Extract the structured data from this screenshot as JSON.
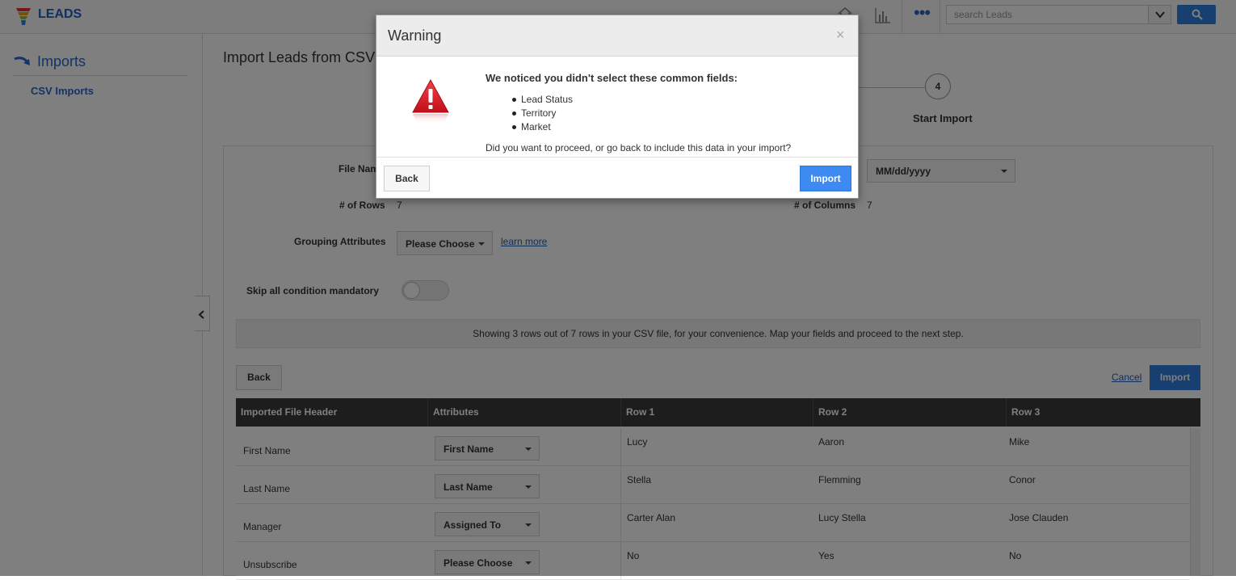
{
  "app": {
    "title": "LEADS"
  },
  "search": {
    "placeholder": "search Leads"
  },
  "sidebar": {
    "title": "Imports",
    "items": [
      {
        "label": "CSV Imports"
      }
    ]
  },
  "page": {
    "title": "Import Leads from CSV",
    "step": {
      "number": "4",
      "label": "Start Import"
    }
  },
  "form": {
    "file_name_label": "File Name",
    "rows_label": "# of Rows",
    "rows_value": "7",
    "columns_label": "# of Columns",
    "columns_value": "7",
    "date_format": "MM/dd/yyyy",
    "grouping_label": "Grouping Attributes",
    "grouping_value": "Please Choose",
    "learn_more": "learn more",
    "skip_label": "Skip all condition mandatory",
    "skip_toggle_on": false
  },
  "info_text": "Showing 3 rows out of 7 rows in your CSV file, for your convenience. Map your fields and proceed to the next step.",
  "actions": {
    "back": "Back",
    "cancel": "Cancel",
    "import": "Import"
  },
  "table": {
    "headers": [
      "Imported File Header",
      "Attributes",
      "Row 1",
      "Row 2",
      "Row 3"
    ],
    "rows": [
      {
        "header": "First Name",
        "attribute": "First Name",
        "r1": "Lucy",
        "r2": "Aaron",
        "r3": "Mike"
      },
      {
        "header": "Last Name",
        "attribute": "Last Name",
        "r1": "Stella",
        "r2": "Flemming",
        "r3": "Conor"
      },
      {
        "header": "Manager",
        "attribute": "Assigned To",
        "r1": "Carter Alan",
        "r2": "Lucy Stella",
        "r3": "Jose Clauden"
      },
      {
        "header": "Unsubscribe",
        "attribute": "Please Choose",
        "r1": "No",
        "r2": "Yes",
        "r3": "No"
      }
    ]
  },
  "modal": {
    "title": "Warning",
    "close": "×",
    "heading": "We noticed you didn't select these common fields:",
    "fields": [
      "Lead Status",
      "Territory",
      "Market"
    ],
    "question": "Did you want to proceed, or go back to include this data in your import?",
    "back": "Back",
    "import": "Import"
  },
  "colors": {
    "accent": "#2f7ee0",
    "link": "#1f5fbf",
    "warning": "#d8141d"
  }
}
